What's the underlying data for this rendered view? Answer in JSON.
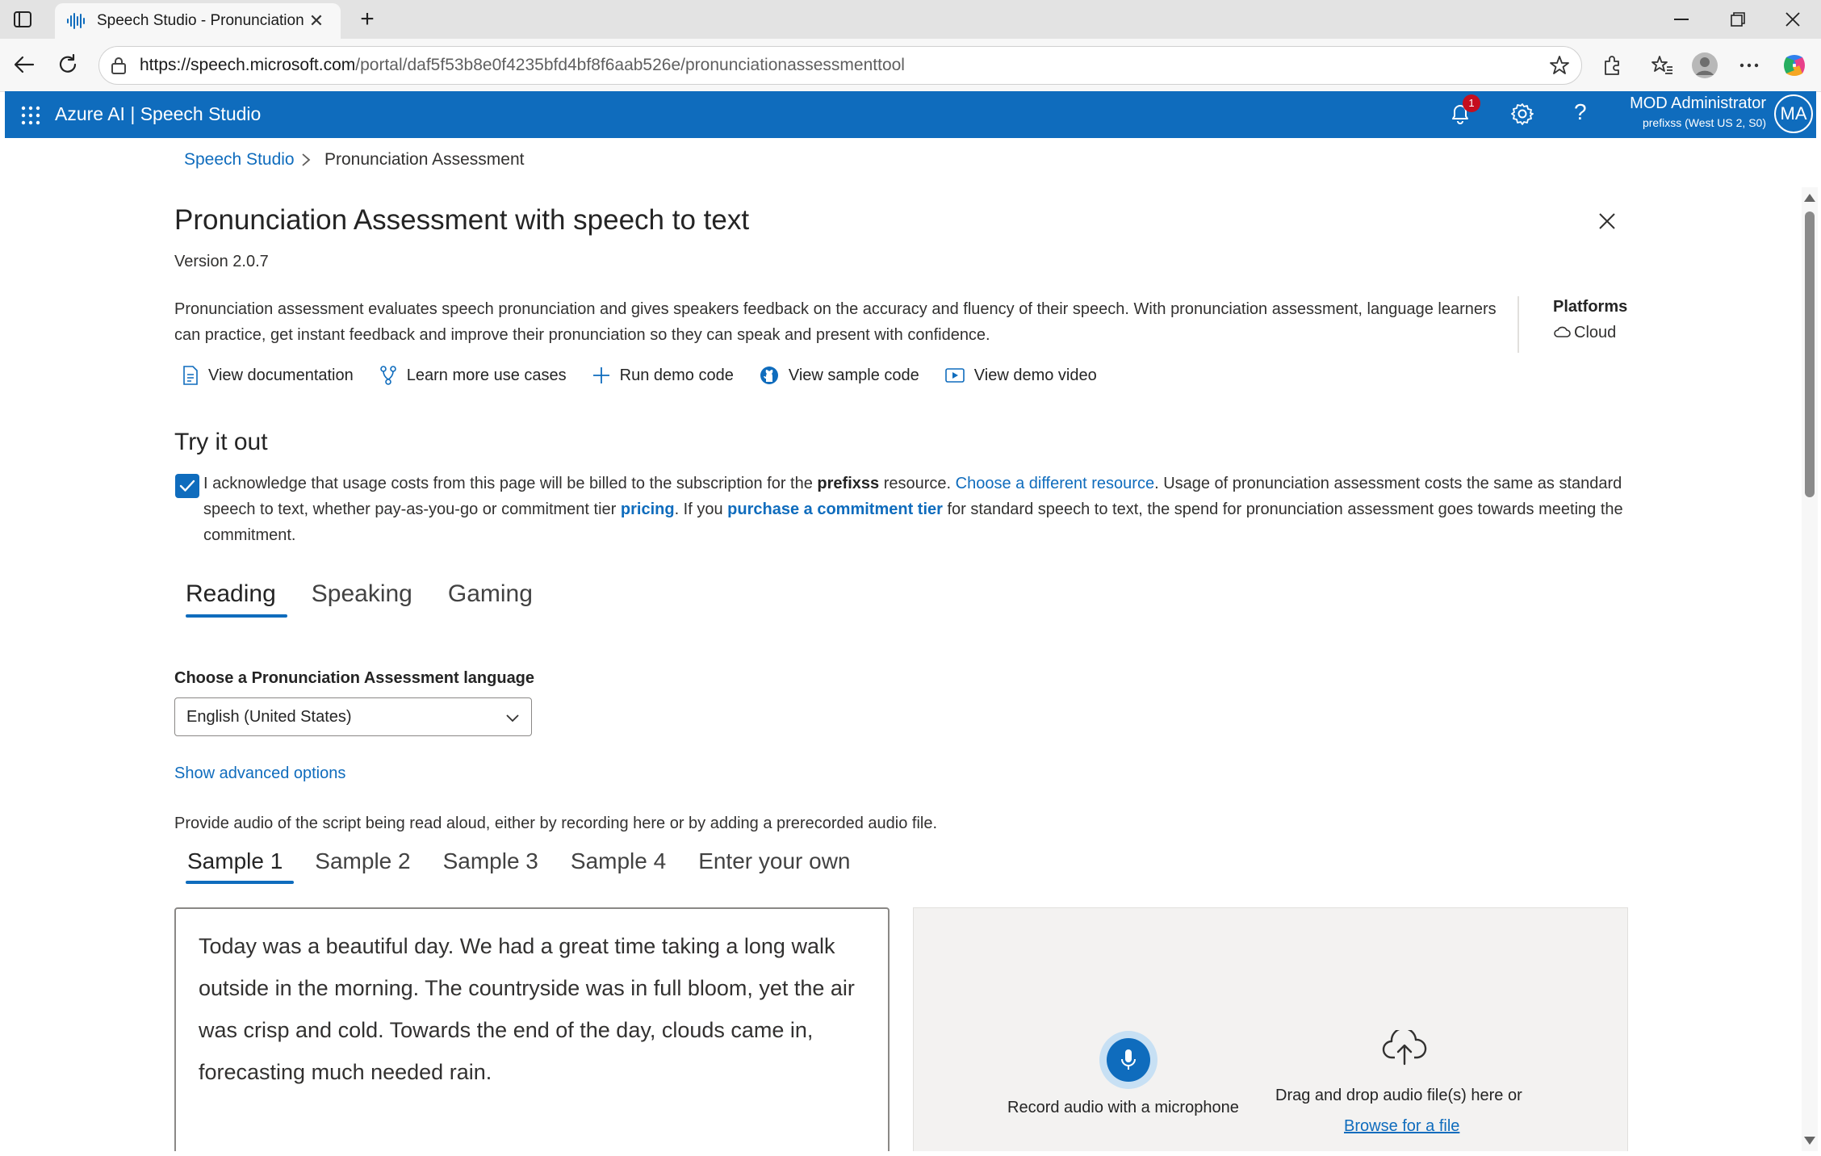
{
  "browser": {
    "tab_title": "Speech Studio - Pronunciation Assessment",
    "new_tab": "+",
    "url_host": "https://speech.microsoft.com",
    "url_path": "/portal/daf5f53b8e0f4235bfd4bf8f6aab526e/pronunciationassessmenttool"
  },
  "appbar": {
    "brand": "Azure AI  |  Speech Studio",
    "notification_count": "1",
    "help": "?",
    "user_name": "MOD Administrator",
    "user_sub": "prefixss (West US 2, S0)",
    "avatar_initials": "MA"
  },
  "breadcrumb": {
    "root": "Speech Studio",
    "current": "Pronunciation Assessment"
  },
  "page": {
    "title": "Pronunciation Assessment with speech to text",
    "version": "Version 2.0.7",
    "description": "Pronunciation assessment evaluates speech pronunciation and gives speakers feedback on the accuracy and fluency of their speech. With pronunciation assessment, language learners can practice, get instant feedback and improve their pronunciation so they can speak and present with confidence.",
    "platforms_label": "Platforms",
    "platforms_value": "Cloud"
  },
  "actions": {
    "docs": "View documentation",
    "use_cases": "Learn more use cases",
    "demo_code": "Run demo code",
    "sample_code": "View sample code",
    "demo_video": "View demo video"
  },
  "try": {
    "title": "Try it out",
    "ack_1": "I acknowledge that usage costs from this page will be billed to the subscription for the ",
    "ack_resource": "prefixss",
    "ack_2": " resource. ",
    "ack_choose": "Choose a different resource",
    "ack_3": ". Usage of pronunciation assessment costs the same as standard speech to text, whether pay-as-you-go or commitment tier ",
    "ack_pricing": "pricing",
    "ack_4": ". If you ",
    "ack_purchase": "purchase a commitment tier",
    "ack_5": " for standard speech to text, the spend for pronunciation assessment goes towards meeting the commitment."
  },
  "mode_tabs": [
    "Reading",
    "Speaking",
    "Gaming"
  ],
  "language": {
    "label": "Choose a Pronunciation Assessment language",
    "selected": "English (United States)"
  },
  "advanced_link": "Show advanced options",
  "provide_text": "Provide audio of the script being read aloud, either by recording here or by adding a prerecorded audio file.",
  "sample_tabs": [
    "Sample 1",
    "Sample 2",
    "Sample 3",
    "Sample 4",
    "Enter your own"
  ],
  "script_text": "Today was a beautiful day. We had a great time taking a long walk outside in the morning. The countryside was in full bloom, yet the air was crisp and cold. Towards the end of the day, clouds came in, forecasting much needed rain.",
  "upload": {
    "record_label": "Record audio with a microphone",
    "drag_label": "Drag and drop audio file(s) here or",
    "browse_label": "Browse for a file"
  },
  "colors": {
    "accent": "#0f6cbd",
    "badge": "#c50f1f"
  }
}
